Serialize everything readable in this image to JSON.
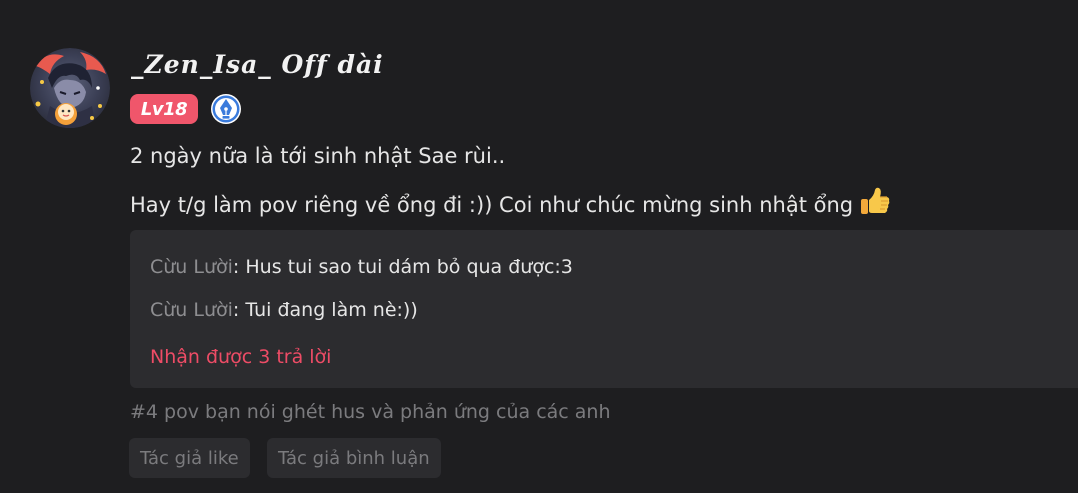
{
  "comment": {
    "username": "_Zen_Isa_ Off dài",
    "level_badge": "Lv18",
    "verified_badge_icon": "pen-nib-icon",
    "lines": [
      "2 ngày nữa là tới sinh nhật Sae rùi..",
      "Hay t/g làm pov riêng về ổng đi :)) Coi như chúc mừng sinh nhật ổng"
    ],
    "emoji": "thumbs-up-icon"
  },
  "replies": {
    "items": [
      {
        "author": "Cừu Lười",
        "separator": ": ",
        "text": "Hus tui sao tui dám bỏ qua được:3"
      },
      {
        "author": "Cừu Lười",
        "separator": ": ",
        "text": "Tui đang làm nè:))"
      }
    ],
    "more_label": "Nhận được 3 trả lời"
  },
  "chapter": "#4 pov bạn nói ghét hus và phản ứng của các anh",
  "tags": [
    "Tác giả like",
    "Tác giả bình luận"
  ],
  "colors": {
    "background": "#1e1e20",
    "panel": "#2c2c2f",
    "accent": "#ee4c66",
    "level_badge": "#f0566b",
    "verified": "#3a7bdc"
  }
}
